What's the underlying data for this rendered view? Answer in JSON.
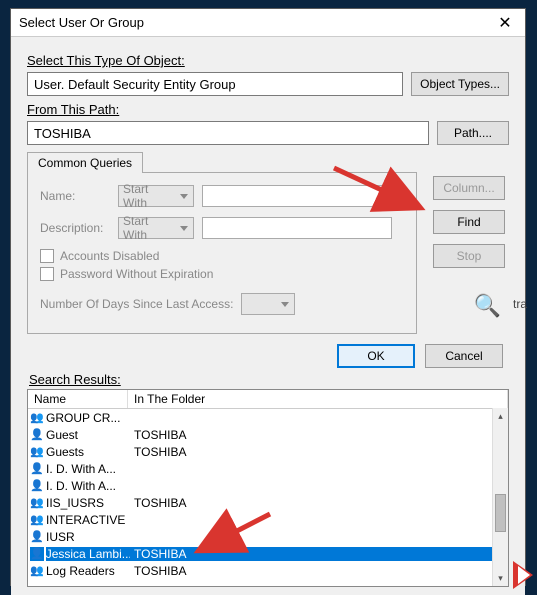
{
  "dialog": {
    "title": "Select User Or Group",
    "objectTypeLabel": "Select This Type Of Object:",
    "objectTypeValue": "User. Default Security Entity Group",
    "objectTypesBtn": "Object Types...",
    "fromPathLabel": "From This Path:",
    "fromPathValue": "TOSHIBA",
    "pathBtn": "Path....",
    "tab": "Common Queries",
    "nameLabel": "Name:",
    "startWith": "Start With",
    "descLabel": "Description:",
    "accountsDisabled": "Accounts Disabled",
    "pwdNoExpire": "Password Without Expiration",
    "daysLabel": "Number Of Days Since Last Access:",
    "columnBtn": "Column...",
    "findBtn": "Find",
    "stopBtn": "Stop",
    "okBtn": "OK",
    "cancelBtn": "Cancel",
    "searchResultsLabel": "Search Results:",
    "colNameHeader": "Name",
    "colFolderHeader": "In The Folder"
  },
  "results": [
    {
      "icon": "group",
      "name": "GROUP CR...",
      "folder": ""
    },
    {
      "icon": "user",
      "name": "Guest",
      "folder": "TOSHIBA"
    },
    {
      "icon": "group",
      "name": "Guests",
      "folder": "TOSHIBA"
    },
    {
      "icon": "user",
      "name": "I. D. With A...",
      "folder": ""
    },
    {
      "icon": "user",
      "name": "I. D. With A...",
      "folder": ""
    },
    {
      "icon": "group",
      "name": "IIS_IUSRS",
      "folder": "TOSHIBA"
    },
    {
      "icon": "group",
      "name": "INTERACTIVE",
      "folder": ""
    },
    {
      "icon": "user",
      "name": "IUSR",
      "folder": ""
    },
    {
      "icon": "user",
      "name": "Jessica Lambi...",
      "folder": "TOSHIBA",
      "selected": true
    },
    {
      "icon": "group",
      "name": "Log Readers",
      "folder": "TOSHIBA"
    }
  ],
  "sideText": "tra"
}
